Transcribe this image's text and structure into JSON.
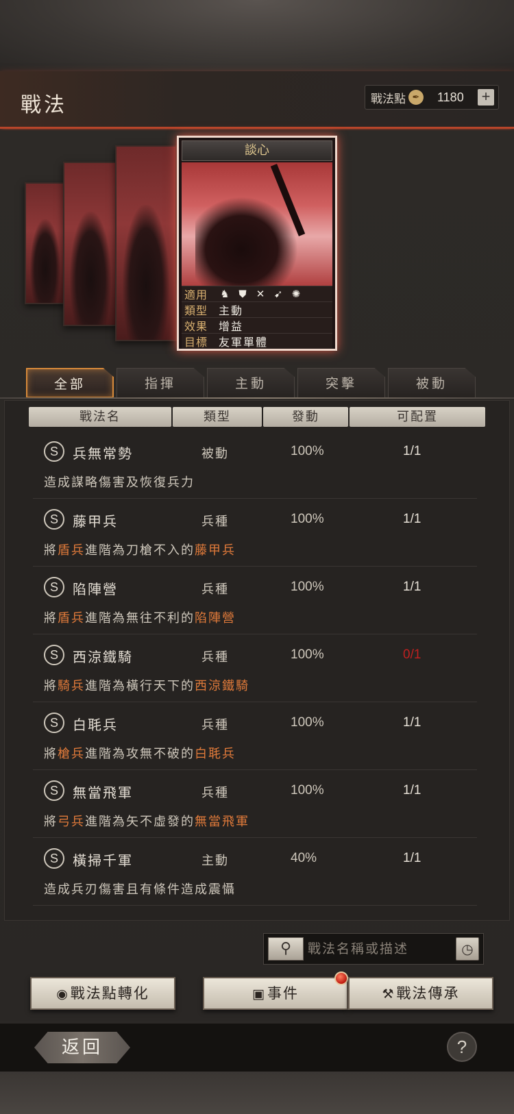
{
  "header": {
    "title": "戰法",
    "points_label": "戰法點",
    "points_icon": "coin-icon",
    "points_value": "1180",
    "plus_label": "+"
  },
  "card": {
    "name": "談心",
    "rows": [
      {
        "key": "適用",
        "value": ""
      },
      {
        "key": "類型",
        "value": "主動"
      },
      {
        "key": "效果",
        "value": "增益"
      },
      {
        "key": "目標",
        "value": "友軍單體"
      }
    ],
    "unit_icons": [
      "cavalry-icon",
      "shield-icon",
      "bow-icon",
      "spear-icon",
      "siege-icon"
    ]
  },
  "tabs": [
    "全部",
    "指揮",
    "主動",
    "突擊",
    "被動"
  ],
  "active_tab": "全部",
  "table": {
    "headers": [
      "戰法名",
      "類型",
      "發動",
      "可配置"
    ],
    "rows": [
      {
        "grade": "S",
        "name": "兵無常勢",
        "type": "被動",
        "rate": "100%",
        "slot": "1/1",
        "desc_pre": "造成謀略傷害及恢復兵力",
        "desc_hl1": "",
        "desc_mid": "",
        "desc_hl2": ""
      },
      {
        "grade": "S",
        "name": "藤甲兵",
        "type": "兵種",
        "rate": "100%",
        "slot": "1/1",
        "desc_pre": "將",
        "desc_hl1": "盾兵",
        "desc_mid": "進階為刀槍不入的",
        "desc_hl2": "藤甲兵"
      },
      {
        "grade": "S",
        "name": "陷陣營",
        "type": "兵種",
        "rate": "100%",
        "slot": "1/1",
        "desc_pre": "將",
        "desc_hl1": "盾兵",
        "desc_mid": "進階為無往不利的",
        "desc_hl2": "陷陣營"
      },
      {
        "grade": "S",
        "name": "西涼鐵騎",
        "type": "兵種",
        "rate": "100%",
        "slot": "0/1",
        "desc_pre": "將",
        "desc_hl1": "騎兵",
        "desc_mid": "進階為橫行天下的",
        "desc_hl2": "西涼鐵騎"
      },
      {
        "grade": "S",
        "name": "白毦兵",
        "type": "兵種",
        "rate": "100%",
        "slot": "1/1",
        "desc_pre": "將",
        "desc_hl1": "槍兵",
        "desc_mid": "進階為攻無不破的",
        "desc_hl2": "白毦兵"
      },
      {
        "grade": "S",
        "name": "無當飛軍",
        "type": "兵種",
        "rate": "100%",
        "slot": "1/1",
        "desc_pre": "將",
        "desc_hl1": "弓兵",
        "desc_mid": "進階為矢不虛發的",
        "desc_hl2": "無當飛軍"
      },
      {
        "grade": "S",
        "name": "橫掃千軍",
        "type": "主動",
        "rate": "40%",
        "slot": "1/1",
        "desc_pre": "造成兵刃傷害且有條件造成震懾",
        "desc_hl1": "",
        "desc_mid": "",
        "desc_hl2": ""
      }
    ]
  },
  "search": {
    "placeholder": "戰法名稱或描述"
  },
  "buttons": {
    "convert": "戰法點轉化",
    "events": "事件",
    "inherit": "戰法傳承"
  },
  "footer": {
    "back": "返回",
    "help": "?"
  },
  "colors": {
    "accent": "#d88a3a",
    "highlight": "#e07a3a",
    "warning": "#c02020"
  }
}
